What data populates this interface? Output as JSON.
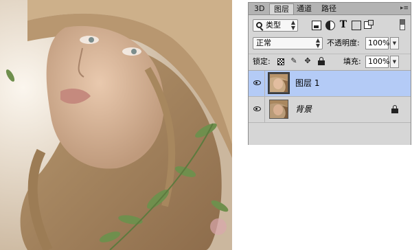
{
  "panel": {
    "tabs": [
      {
        "label": "3D"
      },
      {
        "label": "图层",
        "active": true
      },
      {
        "label": "通道"
      },
      {
        "label": "路径"
      }
    ],
    "menu_icon": "panel-menu-icon",
    "filter": {
      "label": "类型",
      "icon": "search-icon"
    },
    "filter_icons": [
      "image-filter-icon",
      "adjustment-filter-icon",
      "type-filter-icon",
      "shape-filter-icon",
      "smart-object-filter-icon",
      "filter-toggle-icon"
    ],
    "blend_mode": "正常",
    "opacity_label": "不透明度:",
    "opacity_value": "100%",
    "lock_label": "锁定:",
    "lock_icons": [
      "lock-transparent-icon",
      "lock-image-icon",
      "lock-position-icon",
      "lock-all-icon"
    ],
    "fill_label": "填充:",
    "fill_value": "100%",
    "layers": [
      {
        "name": "图层 1",
        "selected": true,
        "visible": true
      },
      {
        "name": "背景",
        "selected": false,
        "visible": true,
        "locked": true,
        "italic": true
      }
    ],
    "colors": {
      "panel_bg": "#d6d6d6",
      "selected_row": "#b4cbf6",
      "tabbar_bg": "#b3b3b3"
    }
  }
}
